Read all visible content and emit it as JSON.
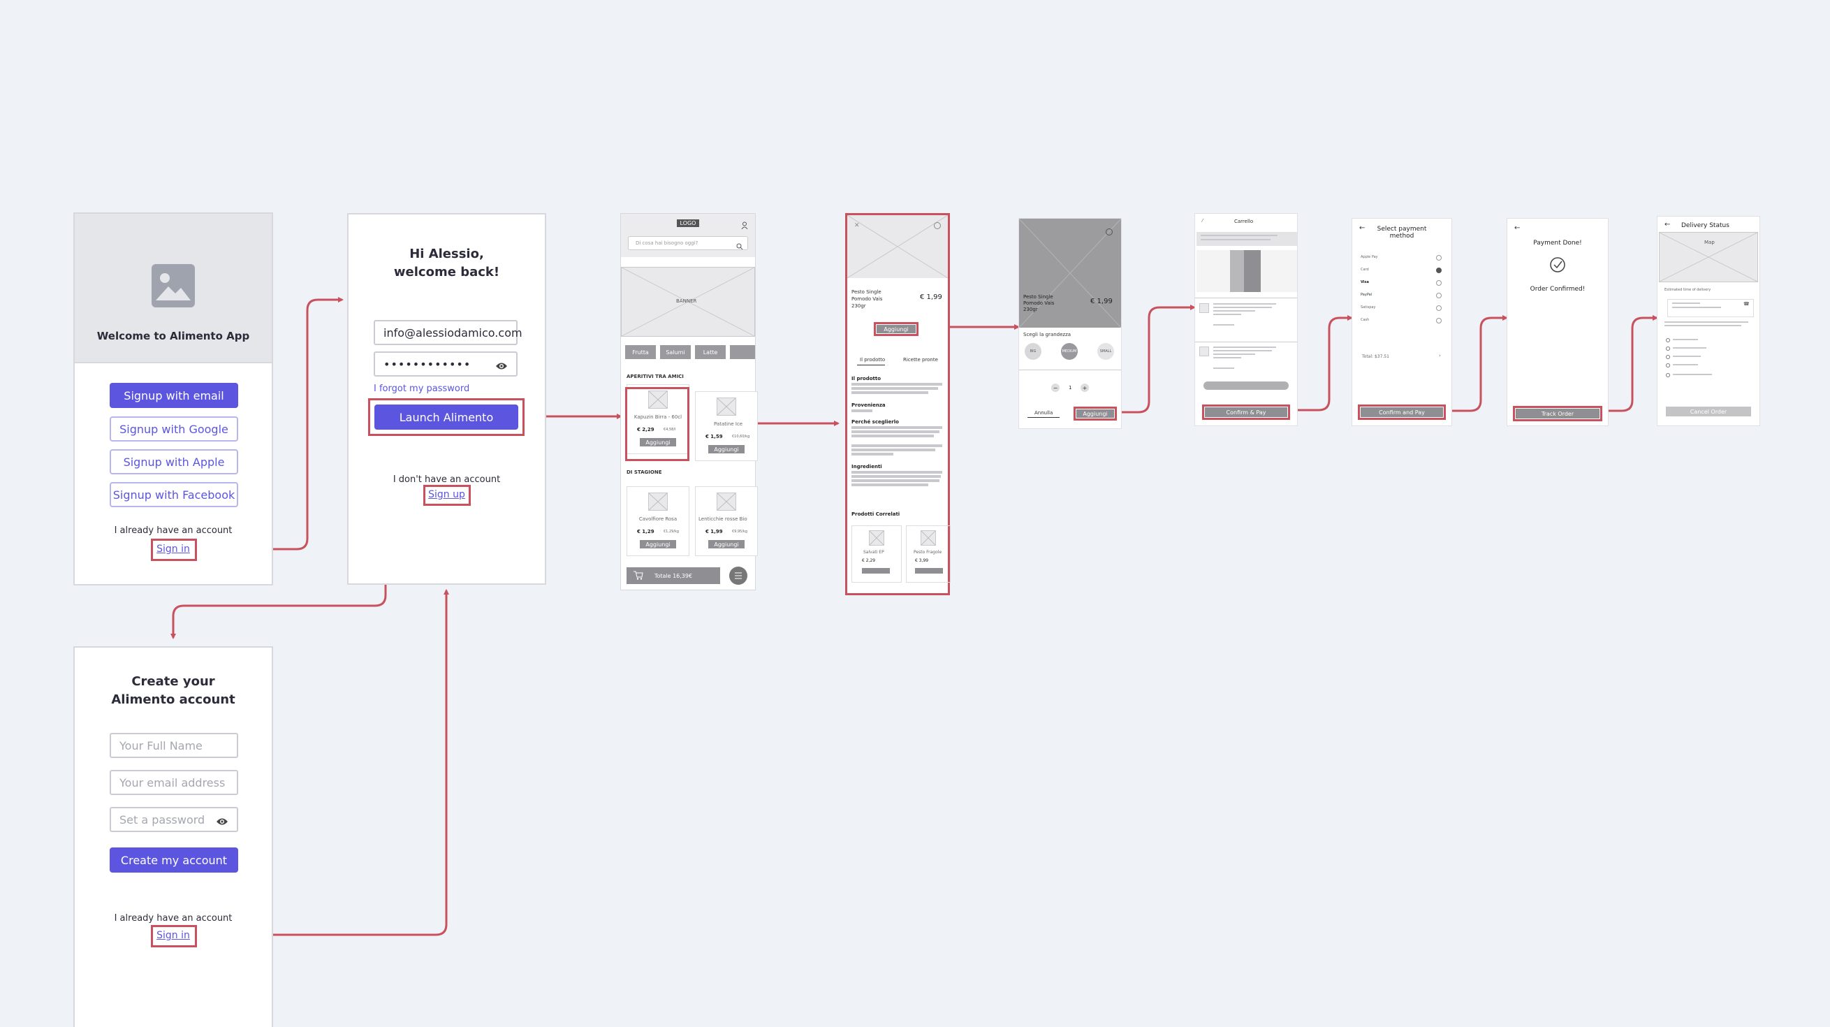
{
  "screen_welcome": {
    "title": "Welcome to Alimento App",
    "buttons": [
      "Signup with email",
      "Signup with Google",
      "Signup with Apple",
      "Signup with Facebook"
    ],
    "already": "I already have an account",
    "signin": "Sign in"
  },
  "screen_login": {
    "greeting_line1": "Hi Alessio,",
    "greeting_line2": "welcome back!",
    "email": "info@alessiodamico.com",
    "password": "••••••••••••",
    "forgot": "I forgot my password",
    "launch": "Launch Alimento",
    "no_account": "I don't have an account",
    "signup": "Sign up"
  },
  "screen_create": {
    "title_line1": "Create your",
    "title_line2": "Alimento account",
    "ph_name": "Your Full Name",
    "ph_email": "Your email address",
    "ph_password": "Set a password",
    "create": "Create my account",
    "already": "I already have an account",
    "signin": "Sign in"
  },
  "screen_home": {
    "logo": "LOGO",
    "search_ph": "Di cosa hai bisogno oggi?",
    "banner": "BANNER",
    "chips": [
      "Frutta",
      "Salumi",
      "Latte"
    ],
    "section1": "APERITIVI TRA AMICI",
    "product1": "Kapuzin Birra - 60cl",
    "price1": "€ 2,29",
    "old1": "€4,58/l",
    "product2": "Patatine Ice",
    "price2": "€ 1,59",
    "old2": "€10,60/kg",
    "add": "Aggiungi",
    "section2": "DI STAGIONE",
    "product3": "Cavolfiore Rosa",
    "price3": "€ 1,29",
    "old3": "€1,29/kg",
    "product4": "Lenticchie rosse Bio",
    "price4": "€ 1,99",
    "old4": "€9,95/kg",
    "total": "Totale 16,39€"
  },
  "screen_product": {
    "name_l1": "Pesto Single",
    "name_l2": "Pomodo Vais",
    "name_l3": "230gr",
    "price": "€ 1,99",
    "add": "Aggiungi",
    "tab1": "Il prodotto",
    "tab2": "Ricette pronte",
    "sec1": "Il prodotto",
    "sec2": "Provenienza",
    "sec3": "Perché sceglierlo",
    "sec4": "Ingredienti",
    "related": "Prodotti Correlati",
    "rel1": "Salvati EP",
    "rel1_price": "€ 2,29",
    "rel2": "Pesto Fragole",
    "rel2_price": "€ 3,99"
  },
  "screen_size": {
    "name_l1": "Pesto Single",
    "name_l2": "Pomodo Vais",
    "name_l3": "230gr",
    "price": "€ 1,99",
    "choose": "Scegli la grandezza",
    "sizes": [
      "BIG",
      "MEDIUM",
      "SMALL"
    ],
    "qty": "1",
    "cancel": "Annulla",
    "add": "Aggiungi"
  },
  "screen_cart": {
    "title": "Carrello",
    "cta": "Confirm & Pay"
  },
  "screen_payment": {
    "title_l1": "Select payment",
    "title_l2": "method",
    "methods": [
      "Apple Pay",
      "Card",
      "Visa",
      "PayPal",
      "Satispay",
      "Cash"
    ],
    "total": "Total: $37.51",
    "cta": "Confirm and Pay"
  },
  "screen_done": {
    "title": "Payment Done!",
    "confirmed": "Order Confirmed!",
    "cta": "Track Order"
  },
  "screen_delivery": {
    "title": "Delivery Status",
    "map": "Map",
    "estimated": "Estimated time of delivery",
    "cta": "Cancel Order"
  }
}
